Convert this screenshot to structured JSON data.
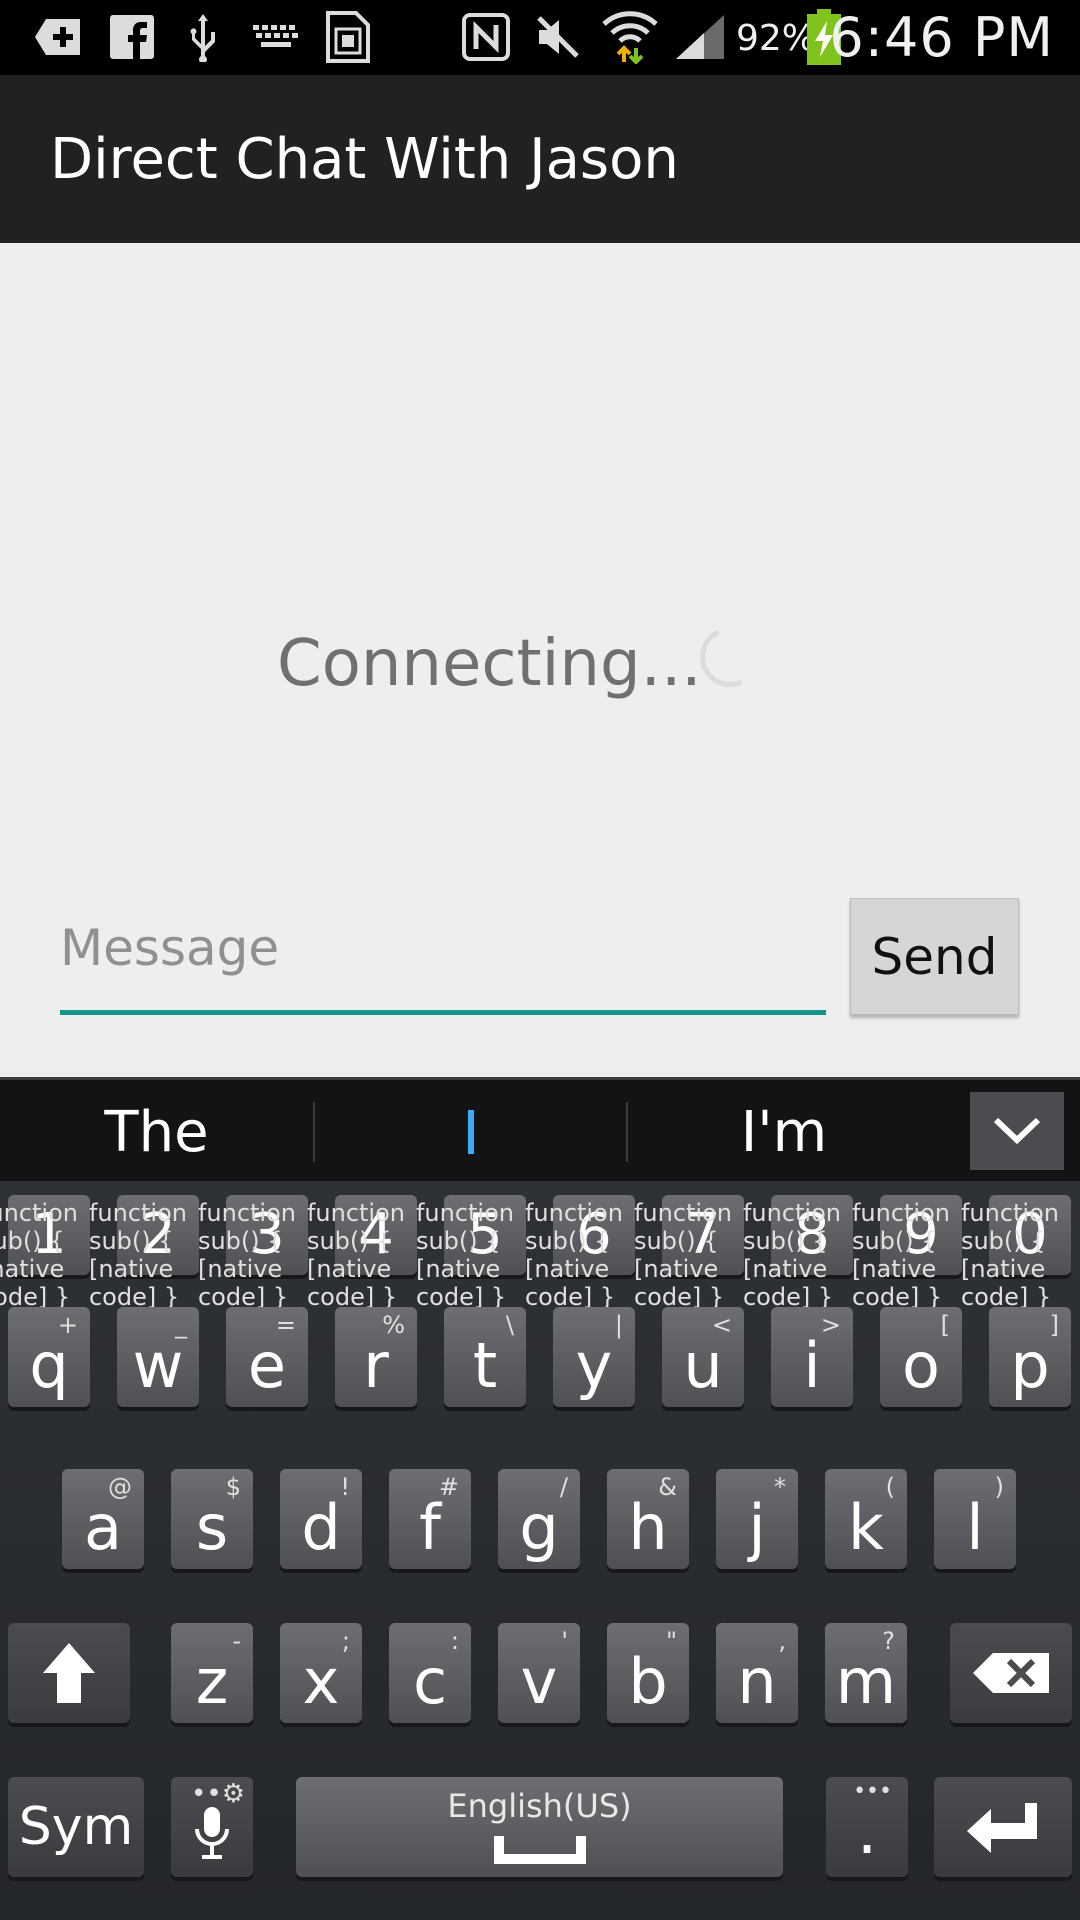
{
  "status_bar": {
    "icons": [
      "add-notification-icon",
      "facebook-icon",
      "usb-icon",
      "keyboard-icon",
      "sim-card-icon",
      "nfc-icon",
      "mute-icon",
      "wifi-icon",
      "signal-icon",
      "battery-charging-icon"
    ],
    "battery_percent": "92%",
    "time": "6:46 PM"
  },
  "action_bar": {
    "title": "Direct Chat With Jason"
  },
  "main": {
    "status_text": "Connecting...",
    "message_placeholder": "Message",
    "message_value": "",
    "send_label": "Send",
    "accent_color": "#12968a"
  },
  "keyboard": {
    "suggestions": [
      "The",
      "I",
      "I'm"
    ],
    "number_row": [
      "1",
      "2",
      "3",
      "4",
      "5",
      "6",
      "7",
      "8",
      "9",
      "0"
    ],
    "row1": [
      {
        "key": "q",
        "sub": "+"
      },
      {
        "key": "w",
        "sub": "_"
      },
      {
        "key": "e",
        "sub": "="
      },
      {
        "key": "r",
        "sub": "%"
      },
      {
        "key": "t",
        "sub": "\\"
      },
      {
        "key": "y",
        "sub": "|"
      },
      {
        "key": "u",
        "sub": "<"
      },
      {
        "key": "i",
        "sub": ">"
      },
      {
        "key": "o",
        "sub": "["
      },
      {
        "key": "p",
        "sub": "]"
      }
    ],
    "row2": [
      {
        "key": "a",
        "sub": "@"
      },
      {
        "key": "s",
        "sub": "$"
      },
      {
        "key": "d",
        "sub": "!"
      },
      {
        "key": "f",
        "sub": "#"
      },
      {
        "key": "g",
        "sub": "/"
      },
      {
        "key": "h",
        "sub": "&"
      },
      {
        "key": "j",
        "sub": "*"
      },
      {
        "key": "k",
        "sub": "("
      },
      {
        "key": "l",
        "sub": ")"
      }
    ],
    "row3": [
      {
        "key": "z",
        "sub": "-"
      },
      {
        "key": "x",
        "sub": ";"
      },
      {
        "key": "c",
        "sub": ":"
      },
      {
        "key": "v",
        "sub": "'"
      },
      {
        "key": "b",
        "sub": "\""
      },
      {
        "key": "n",
        "sub": ","
      },
      {
        "key": "m",
        "sub": "?"
      }
    ],
    "sym_label": "Sym",
    "space_label": "English(US)",
    "period_label": ".",
    "shift_icon": "shift-arrow-icon",
    "backspace_icon": "backspace-icon",
    "enter_icon": "enter-icon",
    "mic_icon": "microphone-icon"
  }
}
